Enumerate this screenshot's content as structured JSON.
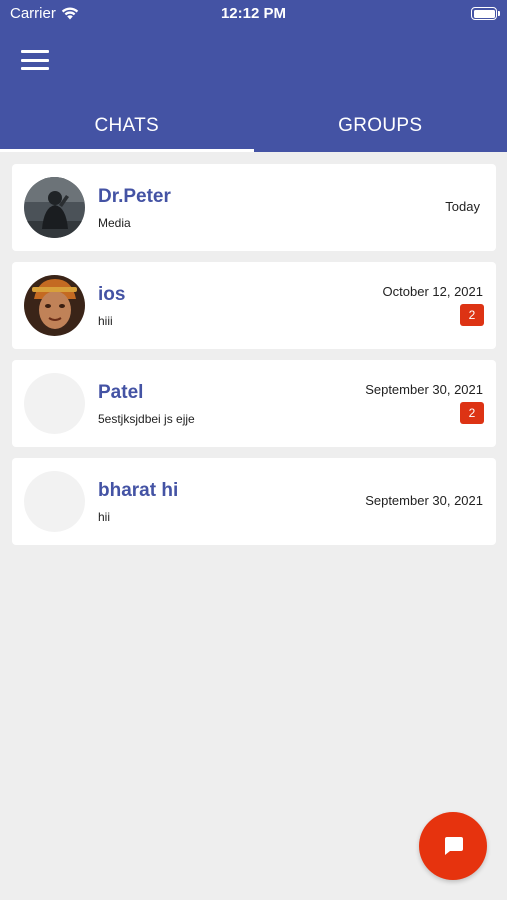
{
  "status_bar": {
    "carrier": "Carrier",
    "time": "12:12 PM"
  },
  "header": {
    "menu_icon": "hamburger-menu-icon",
    "tabs": [
      {
        "label": "CHATS",
        "active": true
      },
      {
        "label": "GROUPS",
        "active": false
      }
    ]
  },
  "chats": [
    {
      "name": "Dr.Peter",
      "message": "Media",
      "date": "Today",
      "unread": "",
      "avatar": "photo-silhouette"
    },
    {
      "name": "ios",
      "message": "hiii",
      "date": "October 12, 2021",
      "unread": "2",
      "avatar": "photo-portrait"
    },
    {
      "name": "Patel",
      "message": "5estjksjdbei js ejje",
      "date": "September 30, 2021",
      "unread": "2",
      "avatar": "placeholder"
    },
    {
      "name": "bharat hi",
      "message": "hii",
      "date": "September 30, 2021",
      "unread": "",
      "avatar": "placeholder"
    }
  ],
  "fab": {
    "icon": "chat-bubble-icon"
  },
  "colors": {
    "primary": "#4453a4",
    "badge": "#dd3314",
    "fab": "#e6330e",
    "background": "#eeeeee"
  }
}
